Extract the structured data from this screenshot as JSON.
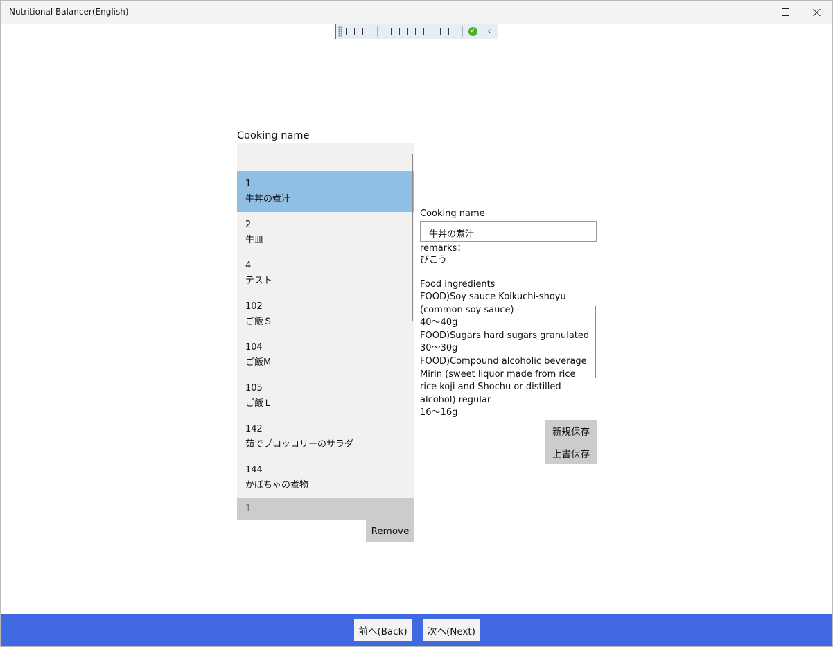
{
  "window": {
    "title": "Nutritional Balancer(English)"
  },
  "left": {
    "label": "Cooking name",
    "items": [
      {
        "num": "1",
        "label": "牛丼の煮汁",
        "selected": true
      },
      {
        "num": "2",
        "label": "牛皿"
      },
      {
        "num": "4",
        "label": "テスト"
      },
      {
        "num": "102",
        "label": "ご飯Ｓ"
      },
      {
        "num": "104",
        "label": "ご飯M"
      },
      {
        "num": "105",
        "label": "ご飯Ｌ"
      },
      {
        "num": "142",
        "label": "茹でブロッコリーのサラダ"
      },
      {
        "num": "144",
        "label": "かぼちゃの煮物"
      }
    ],
    "page": "1",
    "remove_label": "Remove"
  },
  "right": {
    "name_label": "Cooking name",
    "name_value": "牛丼の煮汁",
    "remarks_label": "remarks：",
    "remarks_value": "びこう",
    "ingredients_label": "Food ingredients",
    "ingredients": [
      "FOOD)Soy sauce  Koikuchi-shoyu (common soy sauce)",
      "40～40g",
      "FOOD)Sugars  hard sugars  granulated",
      "30～30g",
      "FOOD)Compound alcoholic beverage  Mirin (sweet liquor made from rice  rice koji and Shochu or distilled alcohol)  regular",
      "16～16g"
    ],
    "save_new_label": "新規保存",
    "overwrite_label": "上書保存"
  },
  "bottom": {
    "back_label": "前へ(Back)",
    "next_label": "次へ(Next)",
    "bar_color": "#4169e1"
  },
  "colors": {
    "selected_item": "#90bfe4",
    "list_bg": "#f1f1f1",
    "button_bg": "#cccccc"
  }
}
